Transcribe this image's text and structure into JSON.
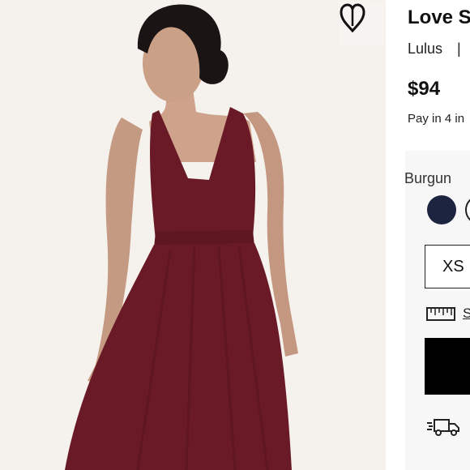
{
  "product": {
    "title": "Love S",
    "brand": "Lulus",
    "separator": "|",
    "price": "$94",
    "installments": "Pay in 4 in",
    "color_label": "Burgun",
    "size": "XS",
    "size_guide": "S"
  },
  "icons": {
    "wishlist": "heart-icon",
    "size_guide": "ruler-icon",
    "shipping": "truck-icon"
  },
  "colors": {
    "dress": "#6a1a26",
    "swatch_navy": "#1d2440",
    "swatch_selected": "#5b1a24",
    "button": "#000000"
  }
}
